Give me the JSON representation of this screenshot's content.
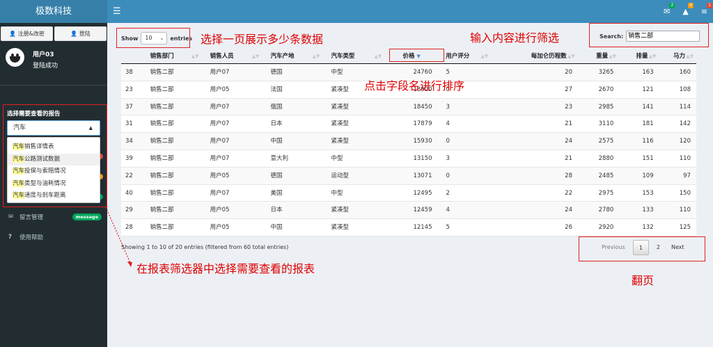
{
  "app": {
    "title": "极数科技"
  },
  "topbar": {
    "icons": [
      {
        "icon": "envelope-icon",
        "badge": "2",
        "badge_color": "#00a65a"
      },
      {
        "icon": "warning-icon",
        "badge": "4",
        "badge_color": "#f39c12"
      },
      {
        "icon": "tasks-icon",
        "badge": "1",
        "badge_color": "#dd4b39"
      }
    ]
  },
  "sidebar": {
    "register_label": "注册&改密",
    "login_label": "登陆",
    "user_name": "用户03",
    "user_status": "登陆成功",
    "report_label": "选择需要查看的报告",
    "report_input": "汽车",
    "dropdown": [
      {
        "hl": "汽车",
        "rest": "销售详情表"
      },
      {
        "hl": "汽车",
        "rest": "公路测试数据"
      },
      {
        "hl": "汽车",
        "rest": "投保与索赔情况"
      },
      {
        "hl": "汽车",
        "rest": "类型与油耗情况"
      },
      {
        "hl": "汽车",
        "rest": "速度与刹车距离"
      }
    ],
    "menu": [
      {
        "icon": "envelope-icon",
        "label": "留言管理",
        "badge": "message"
      },
      {
        "icon": "question-icon",
        "label": "使用帮助"
      }
    ]
  },
  "table_controls": {
    "show_label": "Show",
    "page_length": "10",
    "entries_label": "entries",
    "search_label": "Search:",
    "search_value": "销售二部"
  },
  "table": {
    "columns": [
      "",
      "销售部门",
      "销售人员",
      "汽车产地",
      "汽车类型",
      "价格",
      "用户评分",
      "每加仑历程数",
      "重量",
      "排量",
      "马力"
    ],
    "rows": [
      [
        "38",
        "销售二部",
        "用户07",
        "德国",
        "中型",
        "24760",
        "5",
        "20",
        "3265",
        "163",
        "160"
      ],
      [
        "23",
        "销售二部",
        "用户05",
        "法国",
        "紧凑型",
        "18900",
        "0",
        "27",
        "2670",
        "121",
        "108"
      ],
      [
        "37",
        "销售二部",
        "用户07",
        "俄国",
        "紧凑型",
        "18450",
        "3",
        "23",
        "2985",
        "141",
        "114"
      ],
      [
        "31",
        "销售二部",
        "用户07",
        "日本",
        "紧凑型",
        "17879",
        "4",
        "21",
        "3110",
        "181",
        "142"
      ],
      [
        "34",
        "销售二部",
        "用户07",
        "中国",
        "紧凑型",
        "15930",
        "0",
        "24",
        "2575",
        "116",
        "120"
      ],
      [
        "39",
        "销售二部",
        "用户07",
        "意大利",
        "中型",
        "13150",
        "3",
        "21",
        "2880",
        "151",
        "110"
      ],
      [
        "22",
        "销售二部",
        "用户05",
        "德国",
        "运动型",
        "13071",
        "0",
        "28",
        "2485",
        "109",
        "97"
      ],
      [
        "40",
        "销售二部",
        "用户07",
        "美国",
        "中型",
        "12495",
        "2",
        "22",
        "2975",
        "153",
        "150"
      ],
      [
        "29",
        "销售二部",
        "用户05",
        "日本",
        "紧凑型",
        "12459",
        "4",
        "24",
        "2780",
        "133",
        "110"
      ],
      [
        "28",
        "销售二部",
        "用户05",
        "中国",
        "紧凑型",
        "12145",
        "5",
        "26",
        "2920",
        "132",
        "125"
      ]
    ]
  },
  "info": "Showing 1 to 10 of 20 entries (filtered from 60 total entries)",
  "pagination": {
    "previous": "Previous",
    "pages": [
      "1",
      "2"
    ],
    "next": "Next"
  },
  "annotations": {
    "page_length": "选择一页展示多少条数据",
    "search": "输入内容进行筛选",
    "sort": "点击字段名进行排序",
    "report": "在报表筛选器中选择需要查看的报表",
    "paging": "翻页"
  }
}
